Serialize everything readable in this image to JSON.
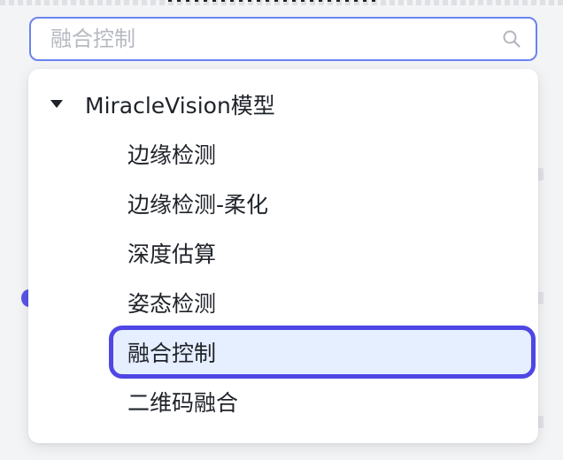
{
  "search": {
    "placeholder": "融合控制",
    "value": ""
  },
  "tree": {
    "group_label": "MiracleVision模型",
    "expanded": true,
    "options": [
      {
        "label": "边缘检测"
      },
      {
        "label": "边缘检测-柔化"
      },
      {
        "label": "深度估算"
      },
      {
        "label": "姿态检测"
      },
      {
        "label": "融合控制",
        "selected": true
      },
      {
        "label": "二维码融合"
      }
    ]
  },
  "colors": {
    "accent": "#4f46e5",
    "focus_border": "#6b83f0",
    "selected_bg": "#e6efff",
    "text": "#1f2329",
    "placeholder": "#b7bac1"
  },
  "icons": {
    "search": "search-icon",
    "expand": "caret-down-icon"
  }
}
